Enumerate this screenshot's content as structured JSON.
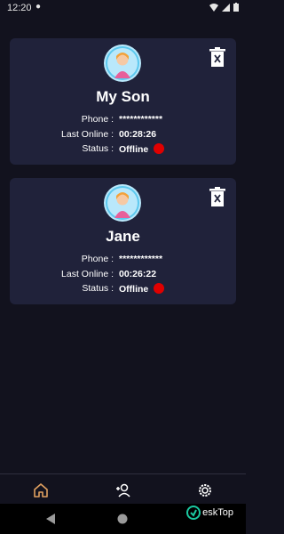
{
  "status_bar": {
    "time": "12:20"
  },
  "contacts": [
    {
      "name": "My Son",
      "phone_label": "Phone :",
      "phone": "************",
      "last_online_label": "Last Online :",
      "last_online": "00:28:26",
      "status_label": "Status :",
      "status": "Offline"
    },
    {
      "name": "Jane",
      "phone_label": "Phone :",
      "phone": "************",
      "last_online_label": "Last Online :",
      "last_online": "00:26:22",
      "status_label": "Status :",
      "status": "Offline"
    }
  ],
  "colors": {
    "background": "#12121e",
    "card": "#20223a",
    "status_offline": "#e00000",
    "nav_active": "#e0a060"
  },
  "bottom_nav": {
    "items": [
      "home-icon",
      "add-person-icon",
      "settings-icon"
    ]
  },
  "watermark": {
    "text": "eskTop"
  }
}
